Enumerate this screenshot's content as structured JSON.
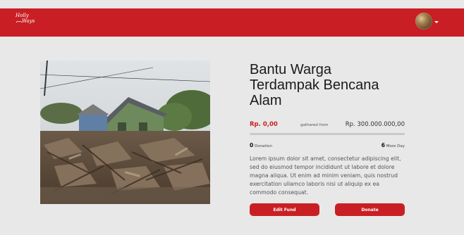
{
  "header": {
    "logo_line1": "Holly",
    "logo_line2": "Ways",
    "accent_color": "#c91f24",
    "avatar_icon": "user-avatar"
  },
  "fund": {
    "title": "Bantu Warga Terdampak Bencana Alam",
    "gathered_amount": "Rp. 0,00",
    "gathered_from_label": "gathered from",
    "target_amount": "Rp. 300.000.000,00",
    "progress_fraction": 0,
    "donation_count": "0",
    "donation_label": "Donation",
    "days_count": "6",
    "days_label": "More Day",
    "description": "Lorem ipsum dolor sit amet, consectetur adipiscing elit, sed do eiusmod tempor incididunt ut labore et dolore magna aliqua. Ut enim ad minim veniam, quis nostrud exercitation ullamco laboris nisi ut aliquip ex ea commodo consequat.",
    "edit_button": "Edit Fund",
    "donate_button": "Donate"
  }
}
